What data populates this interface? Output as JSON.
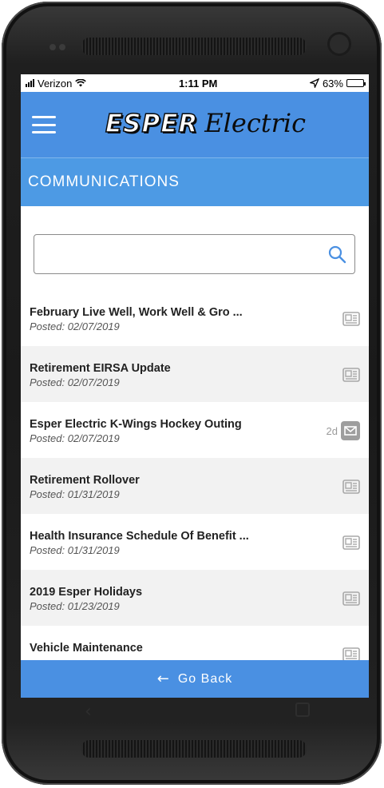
{
  "status": {
    "carrier": "Verizon",
    "time": "1:11 PM",
    "battery": "63%",
    "battery_level": 0.63
  },
  "app": {
    "logo_part1": "ESPER",
    "logo_part2": "Electric",
    "menu_icon": "hamburger-icon",
    "brand_color": "#4a90e2"
  },
  "section": {
    "title": "COMMUNICATIONS"
  },
  "search": {
    "value": "",
    "icon": "search-icon"
  },
  "items": [
    {
      "title": "February Live Well, Work Well & Gro ...",
      "posted": "Posted: 02/07/2019",
      "icon": "newspaper-icon",
      "age": ""
    },
    {
      "title": "Retirement EIRSA Update",
      "posted": "Posted: 02/07/2019",
      "icon": "newspaper-icon",
      "age": ""
    },
    {
      "title": "Esper Electric K-Wings Hockey Outing",
      "posted": "Posted: 02/07/2019",
      "icon": "envelope-icon",
      "age": "2d"
    },
    {
      "title": "Retirement Rollover",
      "posted": "Posted: 01/31/2019",
      "icon": "newspaper-icon",
      "age": ""
    },
    {
      "title": "Health Insurance Schedule Of Benefit ...",
      "posted": "Posted: 01/31/2019",
      "icon": "newspaper-icon",
      "age": ""
    },
    {
      "title": "2019 Esper Holidays",
      "posted": "Posted: 01/23/2019",
      "icon": "newspaper-icon",
      "age": ""
    },
    {
      "title": "Vehicle Maintenance",
      "posted": "",
      "icon": "newspaper-icon",
      "age": ""
    }
  ],
  "footer": {
    "go_back_label": "Go Back"
  }
}
